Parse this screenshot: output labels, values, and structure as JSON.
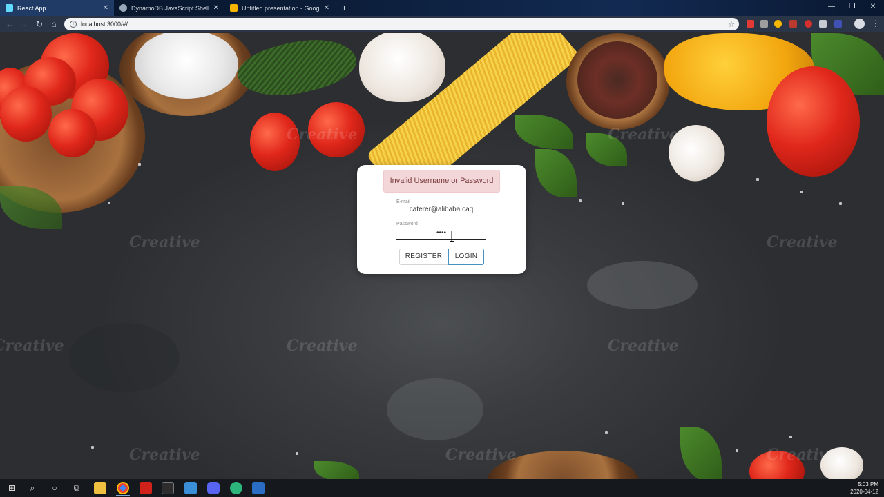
{
  "browser": {
    "tabs": [
      {
        "title": "React App",
        "active": true,
        "favicon": "react-icon",
        "color": "#61dafb"
      },
      {
        "title": "DynamoDB JavaScript Shell",
        "active": false,
        "favicon": "globe-icon",
        "color": "#9aa7b8"
      },
      {
        "title": "Untitled presentation - Google S",
        "active": false,
        "favicon": "slides-icon",
        "color": "#f4b400"
      }
    ],
    "url": "localhost:3000/#/"
  },
  "login": {
    "error": "Invalid Username or Password",
    "email_label": "E-mail",
    "email_value": "caterer@alibaba.caq",
    "password_label": "Password",
    "password_value": "••••",
    "register_label": "REGISTER",
    "login_label": "LOGIN"
  },
  "watermark": "Creative",
  "taskbar": {
    "time": "5:03 PM",
    "date": "2020-04-12",
    "accent": "#7aa9d8"
  }
}
